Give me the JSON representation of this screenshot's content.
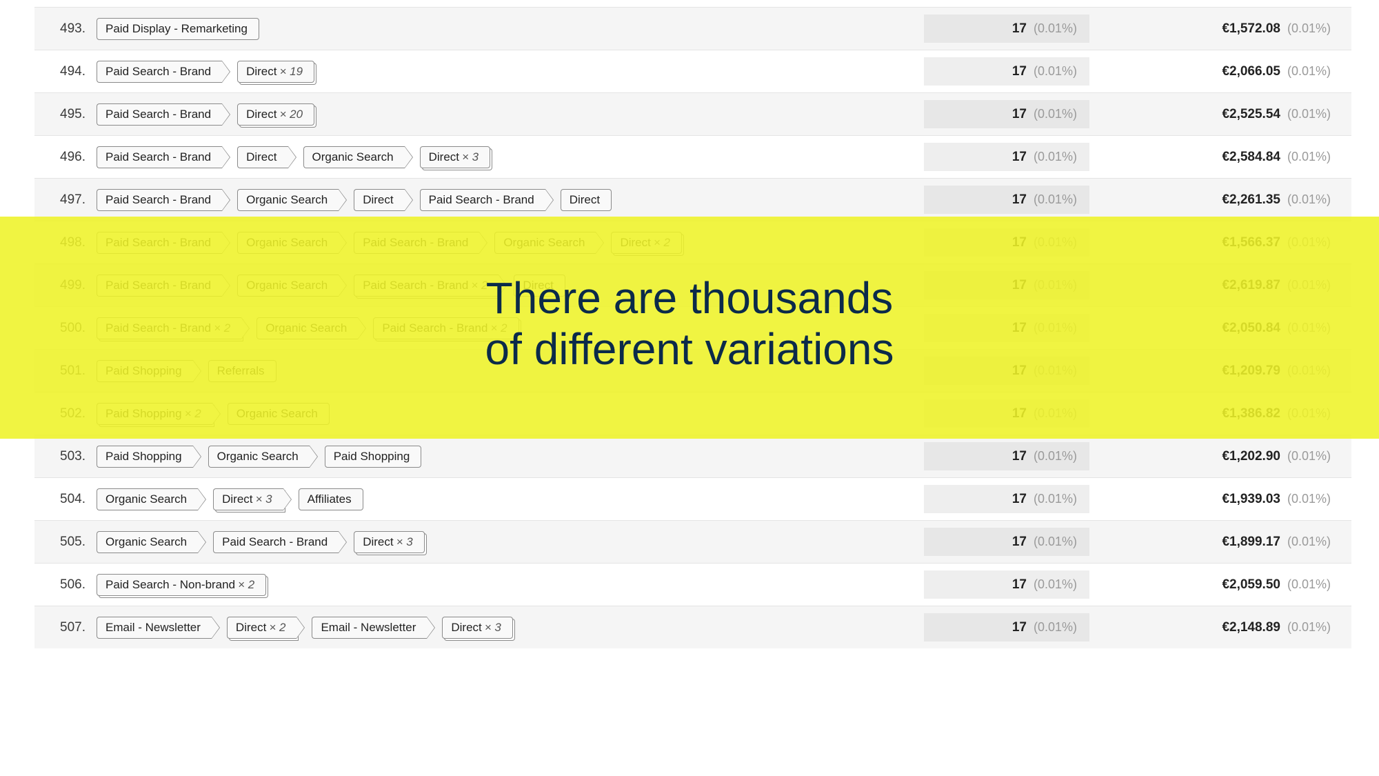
{
  "overlay": {
    "line1": "There are thousands",
    "line2": "of different variations"
  },
  "rows": [
    {
      "n": "493.",
      "count": "17",
      "count_pct": "(0.01%)",
      "rev": "€1,572.08",
      "rev_pct": "(0.01%)",
      "path": [
        {
          "label": "Paid Display - Remarketing",
          "last": true
        }
      ]
    },
    {
      "n": "494.",
      "count": "17",
      "count_pct": "(0.01%)",
      "rev": "€2,066.05",
      "rev_pct": "(0.01%)",
      "path": [
        {
          "label": "Paid Search - Brand"
        },
        {
          "label": "Direct",
          "mult": "× 19",
          "stack": true,
          "last": true
        }
      ]
    },
    {
      "n": "495.",
      "count": "17",
      "count_pct": "(0.01%)",
      "rev": "€2,525.54",
      "rev_pct": "(0.01%)",
      "path": [
        {
          "label": "Paid Search - Brand"
        },
        {
          "label": "Direct",
          "mult": "× 20",
          "stack": true,
          "last": true
        }
      ]
    },
    {
      "n": "496.",
      "count": "17",
      "count_pct": "(0.01%)",
      "rev": "€2,584.84",
      "rev_pct": "(0.01%)",
      "path": [
        {
          "label": "Paid Search - Brand"
        },
        {
          "label": "Direct"
        },
        {
          "label": "Organic Search"
        },
        {
          "label": "Direct",
          "mult": "× 3",
          "stack": true,
          "last": true
        }
      ]
    },
    {
      "n": "497.",
      "count": "17",
      "count_pct": "(0.01%)",
      "rev": "€2,261.35",
      "rev_pct": "(0.01%)",
      "path": [
        {
          "label": "Paid Search - Brand"
        },
        {
          "label": "Organic Search"
        },
        {
          "label": "Direct"
        },
        {
          "label": "Paid Search - Brand"
        },
        {
          "label": "Direct",
          "last": true
        }
      ]
    },
    {
      "n": "498.",
      "count": "17",
      "count_pct": "(0.01%)",
      "rev": "€1,566.37",
      "rev_pct": "(0.01%)",
      "path": [
        {
          "label": "Paid Search - Brand"
        },
        {
          "label": "Organic Search"
        },
        {
          "label": "Paid Search - Brand"
        },
        {
          "label": "Organic Search"
        },
        {
          "label": "Direct",
          "mult": "× 2",
          "stack": true,
          "last": true
        }
      ]
    },
    {
      "n": "499.",
      "count": "17",
      "count_pct": "(0.01%)",
      "rev": "€2,619.87",
      "rev_pct": "(0.01%)",
      "path": [
        {
          "label": "Paid Search - Brand"
        },
        {
          "label": "Organic Search"
        },
        {
          "label": "Paid Search - Brand",
          "mult": "× 2",
          "stack": true
        },
        {
          "label": "Direct",
          "last": true
        }
      ]
    },
    {
      "n": "500.",
      "count": "17",
      "count_pct": "(0.01%)",
      "rev": "€2,050.84",
      "rev_pct": "(0.01%)",
      "path": [
        {
          "label": "Paid Search - Brand",
          "mult": "× 2",
          "stack": true
        },
        {
          "label": "Organic Search"
        },
        {
          "label": "Paid Search - Brand",
          "mult": "× 2",
          "stack": true,
          "last": true
        }
      ]
    },
    {
      "n": "501.",
      "count": "17",
      "count_pct": "(0.01%)",
      "rev": "€1,209.79",
      "rev_pct": "(0.01%)",
      "path": [
        {
          "label": "Paid Shopping"
        },
        {
          "label": "Referrals",
          "last": true
        }
      ]
    },
    {
      "n": "502.",
      "count": "17",
      "count_pct": "(0.01%)",
      "rev": "€1,386.82",
      "rev_pct": "(0.01%)",
      "path": [
        {
          "label": "Paid Shopping",
          "mult": "× 2",
          "stack": true
        },
        {
          "label": "Organic Search",
          "last": true
        }
      ]
    },
    {
      "n": "503.",
      "count": "17",
      "count_pct": "(0.01%)",
      "rev": "€1,202.90",
      "rev_pct": "(0.01%)",
      "path": [
        {
          "label": "Paid Shopping"
        },
        {
          "label": "Organic Search"
        },
        {
          "label": "Paid Shopping",
          "last": true
        }
      ]
    },
    {
      "n": "504.",
      "count": "17",
      "count_pct": "(0.01%)",
      "rev": "€1,939.03",
      "rev_pct": "(0.01%)",
      "path": [
        {
          "label": "Organic Search"
        },
        {
          "label": "Direct",
          "mult": "× 3",
          "stack": true
        },
        {
          "label": "Affiliates",
          "last": true
        }
      ]
    },
    {
      "n": "505.",
      "count": "17",
      "count_pct": "(0.01%)",
      "rev": "€1,899.17",
      "rev_pct": "(0.01%)",
      "path": [
        {
          "label": "Organic Search"
        },
        {
          "label": "Paid Search - Brand"
        },
        {
          "label": "Direct",
          "mult": "× 3",
          "stack": true,
          "last": true
        }
      ]
    },
    {
      "n": "506.",
      "count": "17",
      "count_pct": "(0.01%)",
      "rev": "€2,059.50",
      "rev_pct": "(0.01%)",
      "path": [
        {
          "label": "Paid Search - Non-brand",
          "mult": "× 2",
          "stack": true,
          "last": true
        }
      ]
    },
    {
      "n": "507.",
      "count": "17",
      "count_pct": "(0.01%)",
      "rev": "€2,148.89",
      "rev_pct": "(0.01%)",
      "path": [
        {
          "label": "Email - Newsletter"
        },
        {
          "label": "Direct",
          "mult": "× 2",
          "stack": true
        },
        {
          "label": "Email - Newsletter"
        },
        {
          "label": "Direct",
          "mult": "× 3",
          "stack": true,
          "last": true
        }
      ]
    }
  ],
  "overlay_start_row_index": 5,
  "overlay_end_row_index": 9
}
